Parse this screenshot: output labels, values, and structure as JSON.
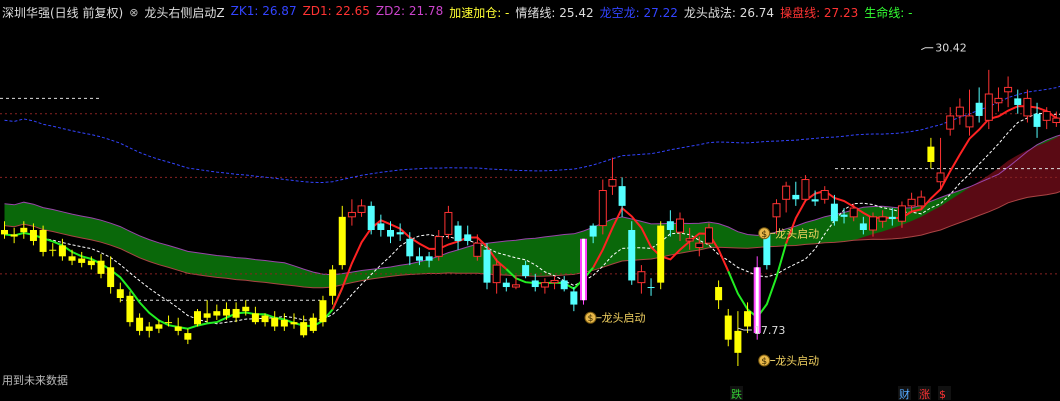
{
  "header": {
    "stock": "深圳华强(日线 前复权)",
    "indicator": "龙头右侧启动Z",
    "items": [
      {
        "label": "ZK1:",
        "value": "26.87",
        "color": "#3344ff"
      },
      {
        "label": "ZD1:",
        "value": "22.65",
        "color": "#ff3333"
      },
      {
        "label": "ZD2:",
        "value": "21.78",
        "color": "#cc44cc"
      },
      {
        "label": "加速加仓:",
        "value": "-",
        "color": "#ffff33"
      },
      {
        "label": "情绪线:",
        "value": "25.42",
        "color": "#dddddd"
      },
      {
        "label": "龙空龙:",
        "value": "27.22",
        "color": "#3344ff"
      },
      {
        "label": "龙头战法:",
        "value": "26.74",
        "color": "#dddddd"
      },
      {
        "label": "操盘线:",
        "value": "27.23",
        "color": "#ff3333"
      },
      {
        "label": "生命线:",
        "value": "-",
        "color": "#33ff33"
      }
    ]
  },
  "footer": {
    "future_data_note": "用到未来数据",
    "markers": [
      {
        "text": "跌",
        "color": "#33cc33"
      },
      {
        "text": "财",
        "color": "#55aaff"
      },
      {
        "text": "涨",
        "color": "#ff3333"
      },
      {
        "text": "$",
        "color": "#ff3333"
      }
    ]
  },
  "colors": {
    "background": "#000000",
    "up_candle": "#ff3333",
    "down_candle": "#54ffff",
    "signal_yellow": "#ffff00",
    "signal_magenta": "#ff44ff",
    "green_band": "#0b6e0b",
    "dark_red_band": "#5a0a14",
    "lifeline": "#22ee22",
    "operating_line": "#ff2222",
    "emotion_line": "#ffffff",
    "blue_line": "#3344ff"
  },
  "chart_data": {
    "type": "candlestick",
    "ylim": [
      16.0,
      31.5
    ],
    "candles": [
      {
        "o": 22.2,
        "h": 22.6,
        "l": 21.8,
        "c": 22.0,
        "k": "y"
      },
      {
        "o": 22.0,
        "h": 22.3,
        "l": 21.6,
        "c": 21.9,
        "k": "y"
      },
      {
        "o": 22.1,
        "h": 22.6,
        "l": 21.8,
        "c": 22.3,
        "k": "y"
      },
      {
        "o": 22.2,
        "h": 22.5,
        "l": 21.5,
        "c": 21.7,
        "k": "y"
      },
      {
        "o": 22.2,
        "h": 22.4,
        "l": 21.0,
        "c": 21.2,
        "k": "y"
      },
      {
        "o": 21.3,
        "h": 21.6,
        "l": 21.0,
        "c": 21.3,
        "k": "y"
      },
      {
        "o": 21.5,
        "h": 21.8,
        "l": 20.8,
        "c": 21.0,
        "k": "y"
      },
      {
        "o": 21.0,
        "h": 21.3,
        "l": 20.6,
        "c": 20.8,
        "k": "y"
      },
      {
        "o": 20.9,
        "h": 21.2,
        "l": 20.5,
        "c": 20.7,
        "k": "y"
      },
      {
        "o": 20.8,
        "h": 21.0,
        "l": 20.4,
        "c": 20.6,
        "k": "y"
      },
      {
        "o": 20.8,
        "h": 21.1,
        "l": 20.0,
        "c": 20.2,
        "k": "y"
      },
      {
        "o": 20.5,
        "h": 21.0,
        "l": 19.3,
        "c": 19.6,
        "k": "y"
      },
      {
        "o": 19.5,
        "h": 19.8,
        "l": 18.9,
        "c": 19.1,
        "k": "y"
      },
      {
        "o": 19.2,
        "h": 19.4,
        "l": 17.8,
        "c": 18.0,
        "k": "y"
      },
      {
        "o": 18.2,
        "h": 18.4,
        "l": 17.4,
        "c": 17.6,
        "k": "y"
      },
      {
        "o": 17.6,
        "h": 18.0,
        "l": 17.3,
        "c": 17.8,
        "k": "y"
      },
      {
        "o": 17.7,
        "h": 18.1,
        "l": 17.5,
        "c": 17.9,
        "k": "y"
      },
      {
        "o": 18.0,
        "h": 18.3,
        "l": 17.8,
        "c": 18.0,
        "k": "y"
      },
      {
        "o": 17.8,
        "h": 18.2,
        "l": 17.4,
        "c": 17.6,
        "k": "y"
      },
      {
        "o": 17.5,
        "h": 17.7,
        "l": 17.0,
        "c": 17.2,
        "k": "y"
      },
      {
        "o": 17.9,
        "h": 18.6,
        "l": 17.8,
        "c": 18.5,
        "k": "y"
      },
      {
        "o": 18.2,
        "h": 19.0,
        "l": 18.0,
        "c": 18.4,
        "k": "y"
      },
      {
        "o": 18.5,
        "h": 18.8,
        "l": 18.1,
        "c": 18.3,
        "k": "y"
      },
      {
        "o": 18.3,
        "h": 18.9,
        "l": 18.1,
        "c": 18.6,
        "k": "y"
      },
      {
        "o": 18.6,
        "h": 18.9,
        "l": 18.0,
        "c": 18.2,
        "k": "y"
      },
      {
        "o": 18.5,
        "h": 19.0,
        "l": 18.3,
        "c": 18.7,
        "k": "y"
      },
      {
        "o": 18.4,
        "h": 18.7,
        "l": 17.9,
        "c": 18.0,
        "k": "y"
      },
      {
        "o": 18.0,
        "h": 18.4,
        "l": 17.8,
        "c": 18.3,
        "k": "y"
      },
      {
        "o": 18.2,
        "h": 18.5,
        "l": 17.6,
        "c": 17.8,
        "k": "y"
      },
      {
        "o": 18.1,
        "h": 18.4,
        "l": 17.6,
        "c": 17.8,
        "k": "y"
      },
      {
        "o": 18.0,
        "h": 18.4,
        "l": 17.7,
        "c": 17.9,
        "k": "y"
      },
      {
        "o": 18.0,
        "h": 18.3,
        "l": 17.3,
        "c": 17.4,
        "k": "y"
      },
      {
        "o": 17.6,
        "h": 18.4,
        "l": 17.5,
        "c": 18.2,
        "k": "y"
      },
      {
        "o": 18.0,
        "h": 19.2,
        "l": 17.8,
        "c": 19.0,
        "k": "y"
      },
      {
        "o": 19.2,
        "h": 20.6,
        "l": 18.8,
        "c": 20.4,
        "k": "y"
      },
      {
        "o": 20.6,
        "h": 23.3,
        "l": 20.4,
        "c": 22.8,
        "k": "y"
      },
      {
        "o": 22.8,
        "h": 23.6,
        "l": 22.4,
        "c": 23.0,
        "k": "r"
      },
      {
        "o": 23.3,
        "h": 23.6,
        "l": 22.8,
        "c": 23.0,
        "k": "r"
      },
      {
        "o": 23.3,
        "h": 23.5,
        "l": 22.0,
        "c": 22.2,
        "k": "c"
      },
      {
        "o": 22.5,
        "h": 22.9,
        "l": 21.9,
        "c": 22.2,
        "k": "c"
      },
      {
        "o": 22.2,
        "h": 22.6,
        "l": 21.6,
        "c": 21.9,
        "k": "c"
      },
      {
        "o": 22.1,
        "h": 22.5,
        "l": 21.7,
        "c": 22.0,
        "k": "c"
      },
      {
        "o": 21.8,
        "h": 22.1,
        "l": 20.6,
        "c": 21.0,
        "k": "c"
      },
      {
        "o": 21.0,
        "h": 21.4,
        "l": 20.6,
        "c": 20.8,
        "k": "c"
      },
      {
        "o": 20.8,
        "h": 21.2,
        "l": 20.5,
        "c": 21.0,
        "k": "c"
      },
      {
        "o": 21.0,
        "h": 22.2,
        "l": 20.8,
        "c": 21.9,
        "k": "r"
      },
      {
        "o": 22.0,
        "h": 23.3,
        "l": 21.8,
        "c": 23.0,
        "k": "r"
      },
      {
        "o": 22.4,
        "h": 22.6,
        "l": 21.3,
        "c": 21.7,
        "k": "c"
      },
      {
        "o": 22.0,
        "h": 22.4,
        "l": 21.5,
        "c": 21.7,
        "k": "c"
      },
      {
        "o": 21.6,
        "h": 22.0,
        "l": 20.8,
        "c": 21.0,
        "k": "r"
      },
      {
        "o": 21.3,
        "h": 21.6,
        "l": 19.5,
        "c": 19.8,
        "k": "c"
      },
      {
        "o": 20.6,
        "h": 20.9,
        "l": 19.3,
        "c": 19.8,
        "k": "r"
      },
      {
        "o": 19.6,
        "h": 20.0,
        "l": 19.4,
        "c": 19.8,
        "k": "c"
      },
      {
        "o": 19.7,
        "h": 20.1,
        "l": 19.5,
        "c": 19.6,
        "k": "r"
      },
      {
        "o": 20.6,
        "h": 20.8,
        "l": 20.0,
        "c": 20.1,
        "k": "c"
      },
      {
        "o": 19.9,
        "h": 20.2,
        "l": 19.4,
        "c": 19.6,
        "k": "c"
      },
      {
        "o": 19.6,
        "h": 20.0,
        "l": 19.3,
        "c": 19.8,
        "k": "r"
      },
      {
        "o": 19.8,
        "h": 20.1,
        "l": 19.5,
        "c": 19.9,
        "k": "r"
      },
      {
        "o": 19.9,
        "h": 20.1,
        "l": 19.4,
        "c": 19.5,
        "k": "c"
      },
      {
        "o": 19.4,
        "h": 19.6,
        "l": 18.5,
        "c": 18.8,
        "k": "c"
      },
      {
        "o": 19.0,
        "h": 21.8,
        "l": 18.8,
        "c": 21.8,
        "k": "m"
      },
      {
        "o": 21.9,
        "h": 22.5,
        "l": 21.6,
        "c": 22.4,
        "k": "c"
      },
      {
        "o": 22.4,
        "h": 24.5,
        "l": 22.0,
        "c": 24.0,
        "k": "r"
      },
      {
        "o": 24.2,
        "h": 25.5,
        "l": 23.8,
        "c": 24.5,
        "k": "r"
      },
      {
        "o": 24.2,
        "h": 24.6,
        "l": 22.8,
        "c": 23.3,
        "k": "c"
      },
      {
        "o": 22.2,
        "h": 22.6,
        "l": 19.7,
        "c": 19.9,
        "k": "c"
      },
      {
        "o": 20.3,
        "h": 20.6,
        "l": 19.3,
        "c": 19.8,
        "k": "r"
      },
      {
        "o": 19.6,
        "h": 20.0,
        "l": 19.2,
        "c": 19.6,
        "k": "c"
      },
      {
        "o": 19.8,
        "h": 22.6,
        "l": 19.5,
        "c": 22.4,
        "k": "y"
      },
      {
        "o": 22.2,
        "h": 23.1,
        "l": 21.9,
        "c": 22.6,
        "k": "c"
      },
      {
        "o": 22.7,
        "h": 23.0,
        "l": 21.7,
        "c": 22.1,
        "k": "r"
      },
      {
        "o": 21.8,
        "h": 22.3,
        "l": 21.3,
        "c": 21.7,
        "k": "r"
      },
      {
        "o": 21.6,
        "h": 21.9,
        "l": 21.0,
        "c": 21.4,
        "k": "r"
      },
      {
        "o": 21.6,
        "h": 22.5,
        "l": 21.5,
        "c": 22.3,
        "k": "r"
      },
      {
        "o": 19.6,
        "h": 19.9,
        "l": 18.6,
        "c": 19.0,
        "k": "y"
      },
      {
        "o": 18.3,
        "h": 18.6,
        "l": 16.9,
        "c": 17.2,
        "k": "y"
      },
      {
        "o": 17.6,
        "h": 18.5,
        "l": 16.0,
        "c": 16.6,
        "k": "y"
      },
      {
        "o": 18.5,
        "h": 18.9,
        "l": 17.5,
        "c": 17.8,
        "k": "y"
      },
      {
        "o": 17.5,
        "h": 21.0,
        "l": 17.2,
        "c": 20.5,
        "k": "m"
      },
      {
        "o": 20.6,
        "h": 22.1,
        "l": 20.4,
        "c": 22.0,
        "k": "c"
      },
      {
        "o": 22.8,
        "h": 23.6,
        "l": 22.0,
        "c": 23.4,
        "k": "r"
      },
      {
        "o": 23.6,
        "h": 24.4,
        "l": 23.0,
        "c": 24.2,
        "k": "r"
      },
      {
        "o": 23.8,
        "h": 24.4,
        "l": 23.3,
        "c": 23.6,
        "k": "c"
      },
      {
        "o": 23.6,
        "h": 24.7,
        "l": 23.5,
        "c": 24.5,
        "k": "r"
      },
      {
        "o": 23.5,
        "h": 24.0,
        "l": 23.3,
        "c": 23.6,
        "k": "c"
      },
      {
        "o": 23.6,
        "h": 24.2,
        "l": 23.4,
        "c": 24.0,
        "k": "r"
      },
      {
        "o": 23.4,
        "h": 23.8,
        "l": 22.4,
        "c": 22.6,
        "k": "c"
      },
      {
        "o": 22.8,
        "h": 23.2,
        "l": 22.5,
        "c": 22.9,
        "k": "c"
      },
      {
        "o": 22.8,
        "h": 23.4,
        "l": 22.6,
        "c": 23.2,
        "k": "r"
      },
      {
        "o": 22.5,
        "h": 22.8,
        "l": 22.0,
        "c": 22.2,
        "k": "c"
      },
      {
        "o": 22.2,
        "h": 23.0,
        "l": 21.9,
        "c": 22.8,
        "k": "r"
      },
      {
        "o": 22.6,
        "h": 23.1,
        "l": 22.3,
        "c": 22.8,
        "k": "r"
      },
      {
        "o": 22.8,
        "h": 23.2,
        "l": 22.4,
        "c": 22.7,
        "k": "c"
      },
      {
        "o": 22.6,
        "h": 23.5,
        "l": 22.3,
        "c": 23.3,
        "k": "r"
      },
      {
        "o": 23.3,
        "h": 23.9,
        "l": 23.0,
        "c": 23.6,
        "k": "r"
      },
      {
        "o": 23.7,
        "h": 24.0,
        "l": 23.1,
        "c": 23.3,
        "k": "r"
      },
      {
        "o": 26.0,
        "h": 26.4,
        "l": 25.0,
        "c": 25.3,
        "k": "y"
      },
      {
        "o": 24.4,
        "h": 26.4,
        "l": 24.0,
        "c": 24.8,
        "k": "r"
      },
      {
        "o": 26.8,
        "h": 27.8,
        "l": 26.5,
        "c": 27.4,
        "k": "r"
      },
      {
        "o": 27.8,
        "h": 28.2,
        "l": 27.0,
        "c": 27.4,
        "k": "r"
      },
      {
        "o": 27.4,
        "h": 28.6,
        "l": 26.5,
        "c": 26.9,
        "k": "r"
      },
      {
        "o": 28.0,
        "h": 28.7,
        "l": 27.1,
        "c": 27.4,
        "k": "c"
      },
      {
        "o": 28.4,
        "h": 29.5,
        "l": 26.8,
        "c": 27.2,
        "k": "r"
      },
      {
        "o": 28.2,
        "h": 28.7,
        "l": 27.6,
        "c": 28.0,
        "k": "r"
      },
      {
        "o": 28.5,
        "h": 29.2,
        "l": 27.8,
        "c": 28.7,
        "k": "r"
      },
      {
        "o": 28.2,
        "h": 28.6,
        "l": 27.5,
        "c": 27.9,
        "k": "c"
      },
      {
        "o": 28.2,
        "h": 28.6,
        "l": 27.1,
        "c": 27.4,
        "k": "r"
      },
      {
        "o": 27.5,
        "h": 28.0,
        "l": 26.4,
        "c": 26.9,
        "k": "c"
      },
      {
        "o": 27.6,
        "h": 27.8,
        "l": 26.8,
        "c": 27.2,
        "k": "r"
      },
      {
        "o": 27.3,
        "h": 27.6,
        "l": 26.9,
        "c": 27.1,
        "k": "r"
      },
      {
        "o": 27.2,
        "h": 27.5,
        "l": 26.9,
        "c": 27.1,
        "k": "r"
      },
      {
        "o": 27.5,
        "h": 27.9,
        "l": 27.0,
        "c": 27.3,
        "k": "r"
      }
    ],
    "annotations": [
      {
        "text": "30.42",
        "type": "high",
        "price": 30.42,
        "index": 95
      },
      {
        "text": "17.73",
        "type": "low",
        "price": 17.73,
        "index": 76
      },
      {
        "text": "龙头启动",
        "type": "signal",
        "index": 60,
        "price": 18.2
      },
      {
        "text": "龙头启动",
        "type": "signal",
        "index": 78,
        "price": 22.05
      },
      {
        "text": "龙头启动",
        "type": "signal",
        "index": 78,
        "price": 16.25
      }
    ],
    "levels": [
      27.5,
      24.6,
      20.2
    ]
  }
}
